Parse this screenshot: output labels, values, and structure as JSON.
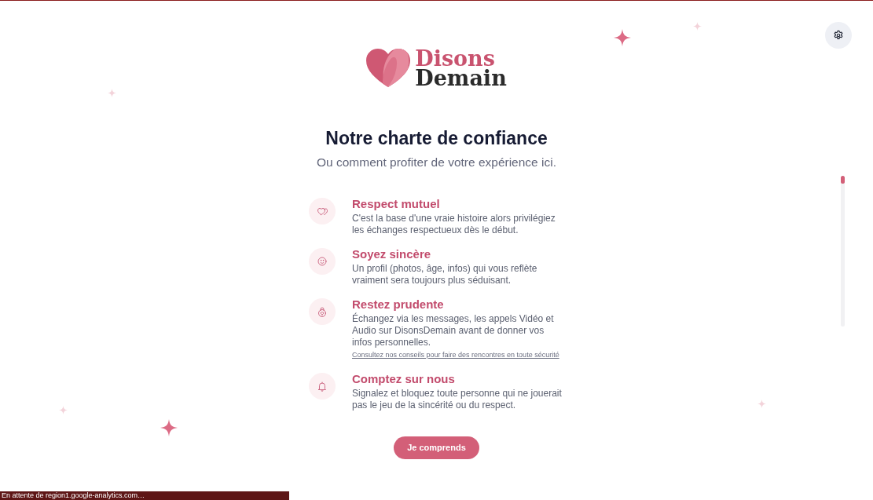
{
  "logo": {
    "line_1": "Disons",
    "line_2": "Demain"
  },
  "title": "Notre charte de confiance",
  "subtitle": "Ou comment profiter de votre expérience ici.",
  "charter_items": [
    {
      "title": "Respect mutuel",
      "description": "C'est la base d'une vraie histoire alors privilégiez les échanges respectueux dès le début."
    },
    {
      "title": "Soyez sincère",
      "description": "Un profil (photos, âge, infos) qui vous reflète vraiment sera toujours plus séduisant."
    },
    {
      "title": "Restez prudente",
      "description": "Échangez via les messages, les appels Vidéo et Audio sur DisonsDemain avant de donner vos infos personnelles.",
      "link": "Consultez nos conseils pour faire des rencontres en toute sécurité"
    },
    {
      "title": "Comptez sur nous",
      "description": "Signalez et bloquez toute personne qui ne jouerait pas le jeu de la sincérité ou du respect."
    }
  ],
  "confirm_button": "Je comprends",
  "status_bar": {
    "text": "En attente de region1.google-analytics.com…"
  }
}
